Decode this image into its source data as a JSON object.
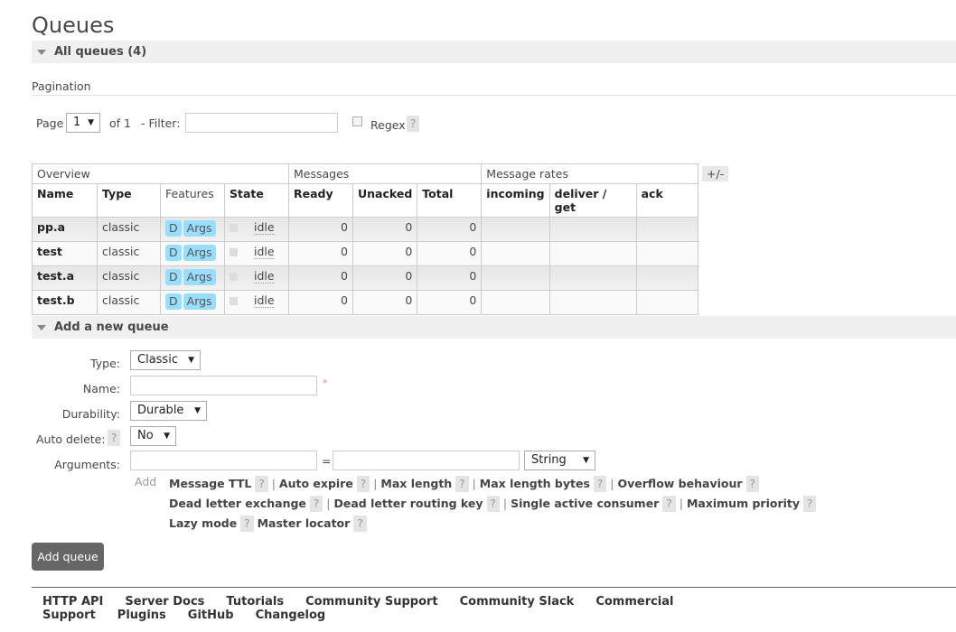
{
  "title": "Queues",
  "all_queues": "All queues (4)",
  "pagination": {
    "label": "Pagination",
    "page_label": "Page",
    "page_value": "1",
    "of": "of 1",
    "filter_label": "- Filter:",
    "filter_value": "",
    "regex_label": "Regex",
    "help": "?"
  },
  "table": {
    "groups": [
      "Overview",
      "Messages",
      "Message rates"
    ],
    "toggle": "+/-",
    "columns": [
      "Name",
      "Type",
      "Features",
      "State",
      "Ready",
      "Unacked",
      "Total",
      "incoming",
      "deliver / get",
      "ack"
    ],
    "rows": [
      {
        "name": "pp.a",
        "type": "classic",
        "f1": "D",
        "f2": "Args",
        "state": "idle",
        "ready": "0",
        "unacked": "0",
        "total": "0"
      },
      {
        "name": "test",
        "type": "classic",
        "f1": "D",
        "f2": "Args",
        "state": "idle",
        "ready": "0",
        "unacked": "0",
        "total": "0"
      },
      {
        "name": "test.a",
        "type": "classic",
        "f1": "D",
        "f2": "Args",
        "state": "idle",
        "ready": "0",
        "unacked": "0",
        "total": "0"
      },
      {
        "name": "test.b",
        "type": "classic",
        "f1": "D",
        "f2": "Args",
        "state": "idle",
        "ready": "0",
        "unacked": "0",
        "total": "0"
      }
    ]
  },
  "add": {
    "header": "Add a new queue",
    "type_label": "Type:",
    "type_value": "Classic",
    "name_label": "Name:",
    "name_value": "",
    "required": "*",
    "durability_label": "Durability:",
    "durability_value": "Durable",
    "autodelete_label": "Auto delete:",
    "autodelete_value": "No",
    "arguments_label": "Arguments:",
    "eq": "=",
    "argtype_value": "String",
    "add_link": "Add",
    "help": "?",
    "args": [
      "Message TTL",
      "Auto expire",
      "Max length",
      "Max length bytes",
      "Overflow behaviour",
      "Dead letter exchange",
      "Dead letter routing key",
      "Single active consumer",
      "Maximum priority",
      "Lazy mode",
      "Master locator"
    ],
    "button": "Add queue"
  },
  "footer": [
    "HTTP API",
    "Server Docs",
    "Tutorials",
    "Community Support",
    "Community Slack",
    "Commercial Support",
    "Plugins",
    "GitHub",
    "Changelog"
  ]
}
